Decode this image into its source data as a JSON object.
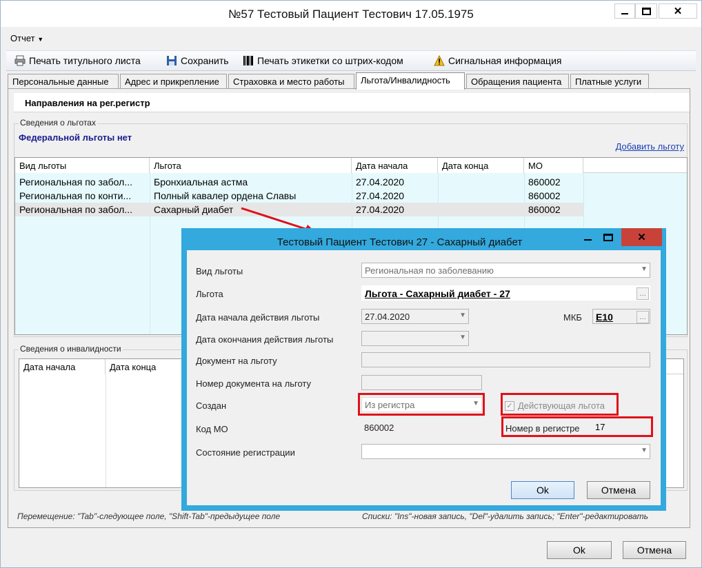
{
  "window": {
    "title": "№57 Тестовый Пациент Тестович 17.05.1975"
  },
  "menu": {
    "report": "Отчет"
  },
  "toolbar": {
    "print_title": "Печать титульного листа",
    "save": "Сохранить",
    "print_label": "Печать этикетки со штрих-кодом",
    "signal_info": "Сигнальная информация"
  },
  "tabs": [
    "Персональные данные",
    "Адрес и прикрепление",
    "Страховка и место работы",
    "Льгота/Инвалидность",
    "Обращения пациента",
    "Платные услуги"
  ],
  "section_header": "Направления на рег.регистр",
  "benefits": {
    "group_title": "Сведения о льготах",
    "federal_note": "Федеральной льготы нет",
    "add_link": "Добавить льготу",
    "columns": [
      "Вид льготы",
      "Льгота",
      "Дата начала",
      "Дата конца",
      "МО"
    ],
    "rows": [
      [
        "Региональная по забол...",
        "Бронхиальная астма",
        "27.04.2020",
        "",
        "860002"
      ],
      [
        "Региональная по конти...",
        "Полный кавалер ордена Славы",
        "27.04.2020",
        "",
        "860002"
      ],
      [
        "Региональная по забол...",
        "Сахарный диабет",
        "27.04.2020",
        "",
        "860002"
      ]
    ]
  },
  "disability": {
    "group_title": "Сведения о инвалидности",
    "columns": [
      "Дата начала",
      "Дата конца"
    ]
  },
  "status": {
    "left": "Перемещение: \"Tab\"-следующее поле, \"Shift-Tab\"-предыдущее поле",
    "right": "Списки: \"Ins\"-новая запись, \"Del\"-удалить запись; \"Enter\"-редактировать"
  },
  "footer": {
    "ok": "Ok",
    "cancel": "Отмена"
  },
  "dialog": {
    "title": "Тестовый Пациент Тестович 27 - Сахарный диабет",
    "labels": {
      "benefit_kind": "Вид льготы",
      "benefit": "Льгота",
      "start_date": "Дата начала действия льготы",
      "end_date": "Дата окончания действия льготы",
      "document": "Документ на льготу",
      "document_number": "Номер документа на льготу",
      "created": "Создан",
      "mo_code": "Код МО",
      "reg_state": "Состояние регистрации",
      "mkb": "МКБ",
      "active": "Действующая льгота",
      "reg_number": "Номер в регистре"
    },
    "values": {
      "benefit_kind": "Региональная по заболеванию",
      "benefit": "Льгота - Сахарный диабет - 27",
      "start_date": "27.04.2020",
      "end_date": "",
      "document": "",
      "document_number": "",
      "created": "Из регистра",
      "mo_code": "860002",
      "reg_state": "",
      "mkb": "E10",
      "reg_number": "17"
    },
    "ok": "Ok",
    "cancel": "Отмена"
  }
}
